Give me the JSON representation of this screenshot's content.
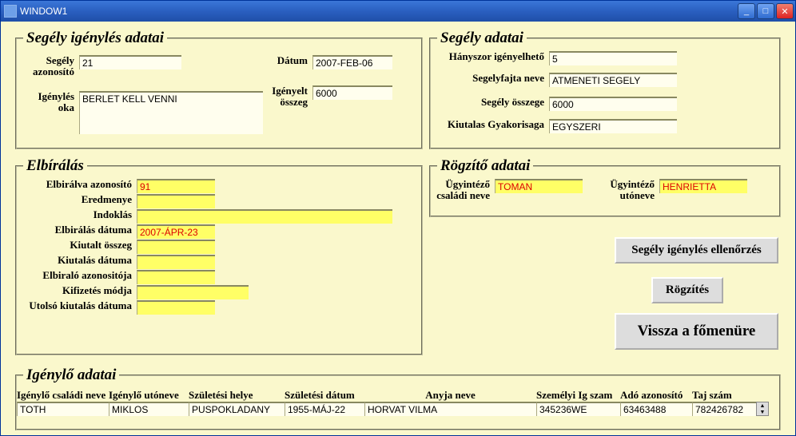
{
  "window": {
    "title": "WINDOW1"
  },
  "boxes": {
    "request": {
      "legend": "Segély igénylés adatai",
      "labels": {
        "id": "Segély azonosító",
        "date": "Dátum",
        "reason": "Igénylés oka",
        "amount": "Igényelt összeg"
      },
      "values": {
        "id": "21",
        "date": "2007-FEB-06",
        "reason": "BERLET KELL VENNI",
        "amount": "6000"
      }
    },
    "aid": {
      "legend": "Segély adatai",
      "labels": {
        "times": "Hányszor igényelhető",
        "type": "Segelyfajta neve",
        "sum": "Segély összege",
        "freq": "Kiutalas Gyakorisaga"
      },
      "values": {
        "times": "5",
        "type": "ATMENETI SEGELY",
        "sum": "6000",
        "freq": "EGYSZERI"
      }
    },
    "review": {
      "legend": "Elbírálás",
      "labels": {
        "rid": "Elbirálva azonosító",
        "result": "Eredmenye",
        "reason": "Indoklás",
        "rdate": "Elbirálás dátuma",
        "paid": "Kiutalt összeg",
        "paydate": "Kiutalás dátuma",
        "reviewer": "Elbiraló azonositója",
        "paymode": "Kifizetés módja",
        "lastpay": "Utolsó kiutalás dátuma"
      },
      "values": {
        "rid": "91",
        "result": "",
        "reason": "",
        "rdate": "2007-ÁPR-23",
        "paid": "",
        "paydate": "",
        "reviewer": "",
        "paymode": "",
        "lastpay": ""
      }
    },
    "recorder": {
      "legend": "Rögzítő adatai",
      "labels": {
        "lname": "Ügyintéző családi neve",
        "fname": "Ügyintéző utóneve"
      },
      "values": {
        "lname": "TOMAN",
        "fname": "HENRIETTA"
      }
    },
    "applicant": {
      "legend": "Igénylő adatai",
      "headers": {
        "lname": "Igénylő családi neve",
        "fname": "Igénylő utóneve",
        "birthplace": "Születési helye",
        "birthdate": "Születési dátum",
        "mother": "Anyja neve",
        "idnum": "Személyi Ig szam",
        "taxid": "Adó azonosító",
        "ssn": "Taj szám"
      },
      "row": {
        "lname": "TOTH",
        "fname": "MIKLOS",
        "birthplace": "PUSPOKLADANY",
        "birthdate": "1955-MÁJ-22",
        "mother": "HORVAT VILMA",
        "idnum": "345236WE",
        "taxid": "63463488",
        "ssn": "782426782"
      }
    }
  },
  "buttons": {
    "check": "Segély igénylés ellenőrzés",
    "record": "Rögzítés",
    "back": "Vissza a főmenüre"
  }
}
